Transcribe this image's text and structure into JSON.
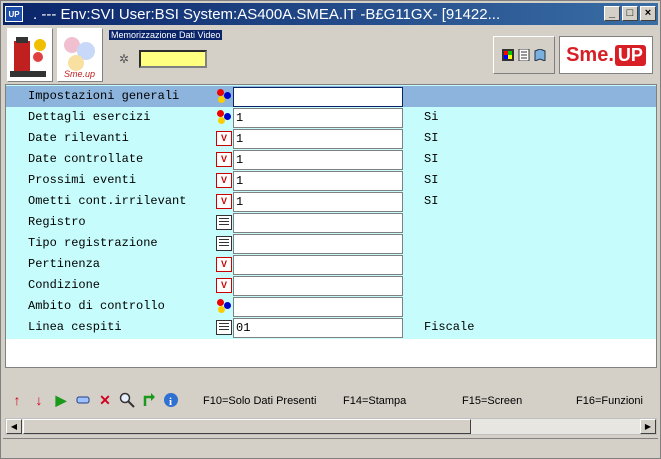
{
  "window": {
    "app_icon": "UP",
    "title": ". --- Env:SVI User:BSI System:AS400A.SMEA.IT -B£G11GX- [91422...",
    "controls": [
      "_",
      "□",
      "×"
    ]
  },
  "toolbar": {
    "memo_label": "Memorizzazione Dati Video",
    "memo_value": "",
    "logo2_text": "Sme.up",
    "brand_sme": "Sme.",
    "brand_up": "UP"
  },
  "form": {
    "rows": [
      {
        "label": "Impostazioni generali",
        "icon": "balls-icon",
        "value": "",
        "desc": ""
      },
      {
        "label": "Dettagli esercizi",
        "icon": "balls-icon",
        "value": "1",
        "desc": "Si"
      },
      {
        "label": "Date rilevanti",
        "icon": "v-icon",
        "value": "1",
        "desc": "SI"
      },
      {
        "label": "Date controllate",
        "icon": "v-icon",
        "value": "1",
        "desc": "SI"
      },
      {
        "label": "Prossimi eventi",
        "icon": "v-icon",
        "value": "1",
        "desc": "SI"
      },
      {
        "label": "Ometti cont.irrilevant",
        "icon": "v-icon",
        "value": "1",
        "desc": "SI"
      },
      {
        "label": "Registro",
        "icon": "list-icon",
        "value": "",
        "desc": ""
      },
      {
        "label": "Tipo registrazione",
        "icon": "list-icon",
        "value": "",
        "desc": ""
      },
      {
        "label": "Pertinenza",
        "icon": "v-icon",
        "value": "",
        "desc": ""
      },
      {
        "label": "Condizione",
        "icon": "v-icon",
        "value": "",
        "desc": ""
      },
      {
        "label": "Ambito di controllo",
        "icon": "balls-icon",
        "value": "",
        "desc": ""
      },
      {
        "label": "Linea cespiti",
        "icon": "list-icon",
        "value": "01",
        "desc": "Fiscale"
      }
    ]
  },
  "function_keys": {
    "f10": "F10=Solo Dati Presenti",
    "f14": "F14=Stampa",
    "f15": "F15=Screen",
    "f16": "F16=Funzioni"
  },
  "icons": {
    "v_glyph": "V",
    "up": "↑",
    "down": "↓",
    "play": "▶",
    "close": "✕",
    "info": "i"
  },
  "colors": {
    "form_background": "#c6fcfc",
    "selected_row": "#8cb4dc",
    "memo_input": "#ffff80",
    "brand_red": "#d91f26",
    "titlebar": "#0a246a"
  }
}
